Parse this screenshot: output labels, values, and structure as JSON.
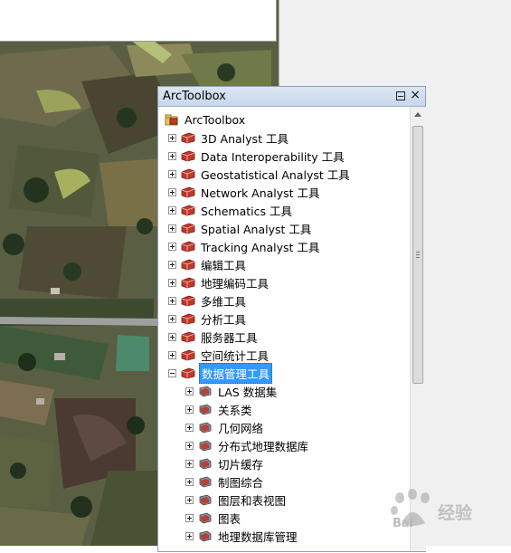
{
  "window": {
    "title": "ArcToolbox",
    "pin_icon": "pin-icon",
    "close_icon": "close-icon",
    "close_glyph": "×"
  },
  "tree": {
    "root": {
      "label": "ArcToolbox",
      "icon": "toolbox-folder-icon"
    },
    "toolsets": [
      {
        "label": "3D Analyst 工具",
        "expanded": false
      },
      {
        "label": "Data Interoperability 工具",
        "expanded": false
      },
      {
        "label": "Geostatistical Analyst 工具",
        "expanded": false
      },
      {
        "label": "Network Analyst 工具",
        "expanded": false
      },
      {
        "label": "Schematics 工具",
        "expanded": false
      },
      {
        "label": "Spatial Analyst 工具",
        "expanded": false
      },
      {
        "label": "Tracking Analyst 工具",
        "expanded": false
      },
      {
        "label": "编辑工具",
        "expanded": false
      },
      {
        "label": "地理编码工具",
        "expanded": false
      },
      {
        "label": "多维工具",
        "expanded": false
      },
      {
        "label": "分析工具",
        "expanded": false
      },
      {
        "label": "服务器工具",
        "expanded": false
      },
      {
        "label": "空间统计工具",
        "expanded": false
      },
      {
        "label": "数据管理工具",
        "expanded": true,
        "selected": true
      }
    ],
    "subtoolsets": [
      {
        "label": "LAS 数据集"
      },
      {
        "label": "关系类"
      },
      {
        "label": "几何网络"
      },
      {
        "label": "分布式地理数据库"
      },
      {
        "label": "切片缓存"
      },
      {
        "label": "制图综合"
      },
      {
        "label": "图层和表视图"
      },
      {
        "label": "图表"
      },
      {
        "label": "地理数据库管理"
      }
    ]
  },
  "watermark": {
    "text": "经验",
    "brand": "Bai"
  },
  "colors": {
    "selection": "#3399ff",
    "toolbox_red": "#b8332b",
    "titlebar": "#c8d7ea"
  }
}
